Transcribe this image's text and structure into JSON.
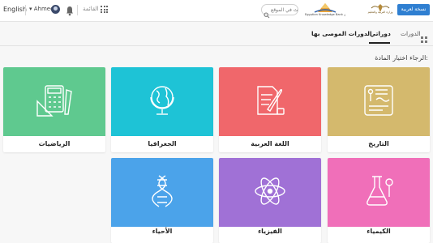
{
  "header": {
    "language_label": "English",
    "user_name": "Ahmed",
    "menu_label": "القائمة",
    "search_placeholder": "البحث في الموقع",
    "partner_logo_text": "Egyptian Knowledge Bank بنك المعرفة المصري",
    "ministry_logo_text": "وزارة التربية والتعليم",
    "arabic_version_button": "نسخة لعربية"
  },
  "tabs": {
    "courses": "الدورات",
    "my_courses": "دوراتي",
    "recommended": "الدورات الموصى بها"
  },
  "prompt": "الرجاء اختيار المادة:",
  "subjects": [
    {
      "label": "التاريخ",
      "color": "#d4b96d",
      "icon": "history-tablet-icon"
    },
    {
      "label": "اللغة العربية",
      "color": "#f0676b",
      "icon": "quill-ink-icon"
    },
    {
      "label": "الجغرافيا",
      "color": "#1ec3d6",
      "icon": "globe-icon"
    },
    {
      "label": "الرياضيات",
      "color": "#5fc98f",
      "icon": "calculator-ruler-icon"
    },
    {
      "label": "الكيمياء",
      "color": "#f06fb9",
      "icon": "flask-icon"
    },
    {
      "label": "الفيزياء",
      "color": "#a071d6",
      "icon": "atom-icon"
    },
    {
      "label": "الأحياء",
      "color": "#4ba3ea",
      "icon": "dna-icon"
    }
  ]
}
